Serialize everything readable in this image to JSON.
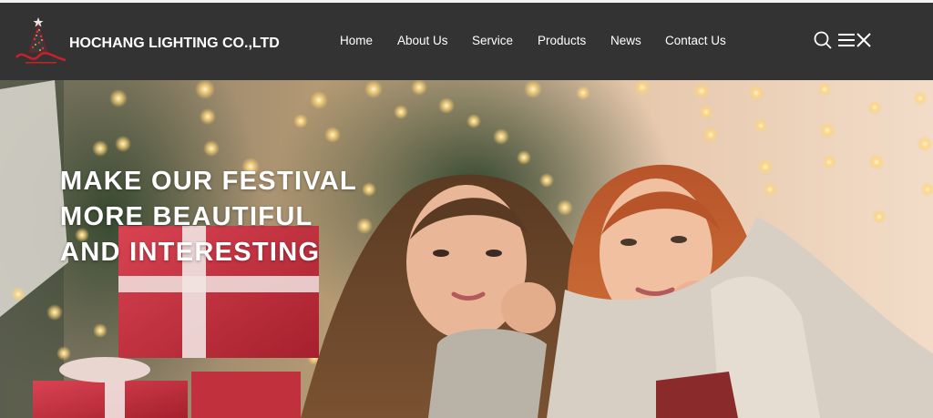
{
  "header": {
    "logo": {
      "icon": "christmas-tree-logo-icon",
      "script_text": "Hochang",
      "tagline": "CHRISTMAS LIGHTS"
    },
    "brand_name": "HOCHANG LIGHTING CO.,LTD",
    "nav": [
      {
        "id": "home",
        "label": "Home"
      },
      {
        "id": "about-us",
        "label": "About Us"
      },
      {
        "id": "service",
        "label": "Service"
      },
      {
        "id": "products",
        "label": "Products"
      },
      {
        "id": "news",
        "label": "News"
      },
      {
        "id": "contact-us",
        "label": "Contact Us"
      }
    ],
    "icons": {
      "search": "search-icon",
      "menu": "menu-icon",
      "close": "close-icon"
    }
  },
  "hero": {
    "headline_lines": [
      "MAKE OUR FESTIVAL",
      "MORE BEAUTIFUL",
      "AND INTERESTING"
    ],
    "image": "hero-photo"
  },
  "colors": {
    "navbar_bg": "#333333",
    "nav_text": "#ffffff",
    "logo_red": "#c8202b",
    "headline_text": "#ffffff"
  }
}
